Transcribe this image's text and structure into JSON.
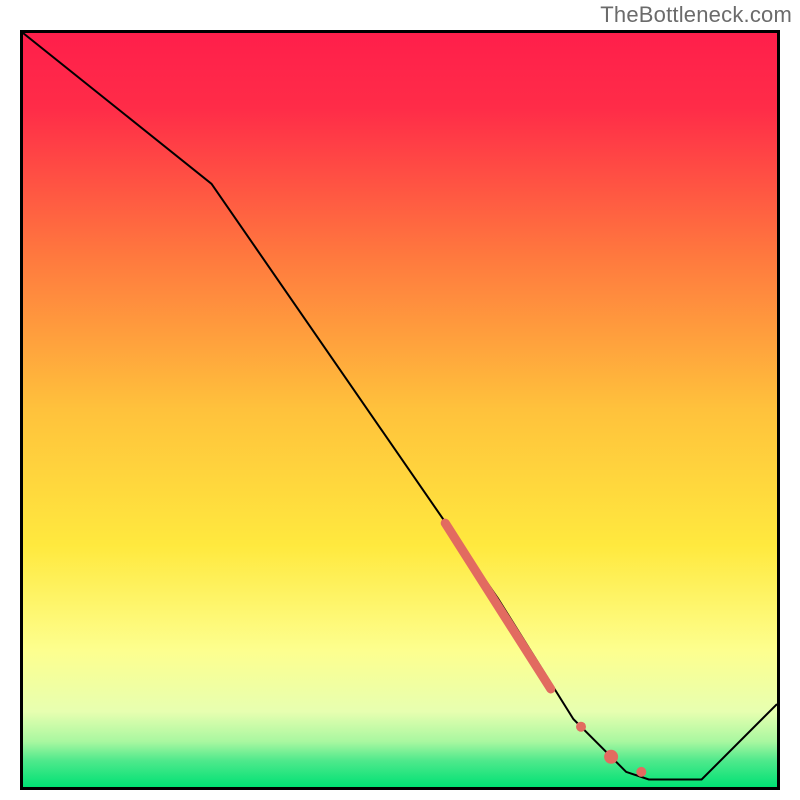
{
  "watermark": "TheBottleneck.com",
  "palette": {
    "top_red": "#ff1f4b",
    "mid_orange": "#ffa43a",
    "mid_yellow": "#ffe93e",
    "pale_yellow": "#feffc0",
    "near_bottom_green": "#86f29a",
    "bottom_green": "#00e174",
    "line_black": "#000000",
    "marker_red": "#e26b60"
  },
  "chart_data": {
    "type": "line",
    "title": "",
    "xlabel": "",
    "ylabel": "",
    "xlim": [
      0,
      100
    ],
    "ylim": [
      0,
      100
    ],
    "series": [
      {
        "name": "bottleneck-curve",
        "x": [
          0,
          25,
          63,
          73,
          78,
          80,
          83,
          90,
          100
        ],
        "y": [
          100,
          80,
          25,
          9,
          4,
          2,
          1,
          1,
          11
        ],
        "stroke": "#000000",
        "stroke_width": 2
      }
    ],
    "thick_segment": {
      "start_x": 56,
      "start_y": 35,
      "end_x": 70,
      "end_y": 13,
      "color": "#e26b60",
      "width": 9
    },
    "markers": [
      {
        "x": 74,
        "y": 8,
        "r": 5,
        "color": "#e26b60"
      },
      {
        "x": 78,
        "y": 4,
        "r": 7,
        "color": "#e26b60"
      },
      {
        "x": 82,
        "y": 2,
        "r": 5,
        "color": "#e26b60"
      }
    ],
    "gradient_stops": [
      {
        "offset": 0.0,
        "color": "#ff1f4b"
      },
      {
        "offset": 0.1,
        "color": "#ff2c48"
      },
      {
        "offset": 0.3,
        "color": "#ff7a3e"
      },
      {
        "offset": 0.5,
        "color": "#ffc23c"
      },
      {
        "offset": 0.68,
        "color": "#ffe93e"
      },
      {
        "offset": 0.82,
        "color": "#fdff8f"
      },
      {
        "offset": 0.9,
        "color": "#e7ffb0"
      },
      {
        "offset": 0.94,
        "color": "#a8f7a0"
      },
      {
        "offset": 0.965,
        "color": "#4fe98c"
      },
      {
        "offset": 1.0,
        "color": "#00e174"
      }
    ]
  }
}
